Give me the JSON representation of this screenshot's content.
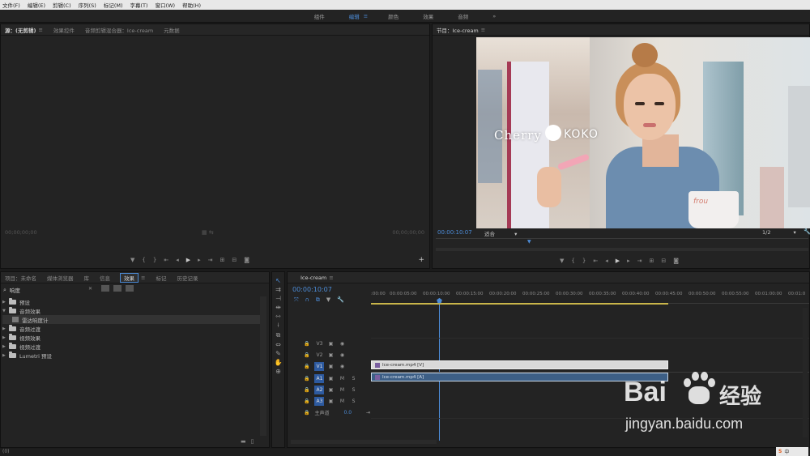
{
  "menu": [
    "文件(F)",
    "编辑(E)",
    "剪辑(C)",
    "序列(S)",
    "标记(M)",
    "字幕(T)",
    "窗口(W)",
    "帮助(H)"
  ],
  "workspaces": [
    {
      "label": "组件",
      "active": false
    },
    {
      "label": "编辑",
      "active": true
    },
    {
      "label": "颜色",
      "active": false
    },
    {
      "label": "效果",
      "active": false
    },
    {
      "label": "音频",
      "active": false
    }
  ],
  "workspace_more": "»",
  "workspace_menu": "≡",
  "source": {
    "tabs": [
      "源：(无剪辑)",
      "效果控件",
      "音频剪辑混合器：Ice-cream",
      "元数据"
    ],
    "tab_menu": "≡",
    "tc_left": "00;00;00;00",
    "tc_right": "00;00;00;00"
  },
  "program": {
    "title": "节目：Ice-cream",
    "tab_menu": "≡",
    "timecode": "00:00:10:07",
    "fit": "适合",
    "resolution": "1/2",
    "overlay_text_1": "Cherry",
    "overlay_text_2": "KOKO",
    "shop_sign": "frou"
  },
  "effects": {
    "tabs": [
      "项目：未命名",
      "媒体浏览器",
      "库",
      "信息",
      "效果",
      "标记",
      "历史记录"
    ],
    "tab_menu": "≡",
    "search": "响度",
    "tree": [
      {
        "label": "预设",
        "level": 0,
        "type": "folder",
        "expanded": false
      },
      {
        "label": "音频效果",
        "level": 0,
        "type": "folder",
        "expanded": true
      },
      {
        "label": "雷达响度计",
        "level": 1,
        "type": "effect",
        "expanded": false
      },
      {
        "label": "音频过渡",
        "level": 0,
        "type": "folder",
        "expanded": false
      },
      {
        "label": "视频效果",
        "level": 0,
        "type": "folder",
        "expanded": false
      },
      {
        "label": "视频过渡",
        "level": 0,
        "type": "folder",
        "expanded": false
      },
      {
        "label": "Lumetri 预设",
        "level": 0,
        "type": "folder",
        "expanded": false
      }
    ]
  },
  "timeline": {
    "sequence": "Ice-cream",
    "tab_menu": "≡",
    "timecode": "00:00:10:07",
    "ruler": [
      ":00:00",
      "00:00:05:00",
      "00:00:10:00",
      "00:00:15:00",
      "00:00:20:00",
      "00:00:25:00",
      "00:00:30:00",
      "00:00:35:00",
      "00:00:40:00",
      "00:00:45:00",
      "00:00:50:00",
      "00:00:55:00",
      "00:01:00:00",
      "00:01:0"
    ],
    "video_tracks": [
      "V3",
      "V2",
      "V1"
    ],
    "audio_tracks": [
      "A1",
      "A2",
      "A3"
    ],
    "master_label": "主声道",
    "master_value": "0.0",
    "mute": "M",
    "solo": "S",
    "clip_video": "Ice-cream.mp4 [V]",
    "clip_audio": "Ice-cream.mp4 [A]"
  },
  "watermark": {
    "brand": "Bai",
    "brand_cn": "经验",
    "url": "jingyan.baidu.com"
  },
  "status": "(0)",
  "tray_label": "中"
}
